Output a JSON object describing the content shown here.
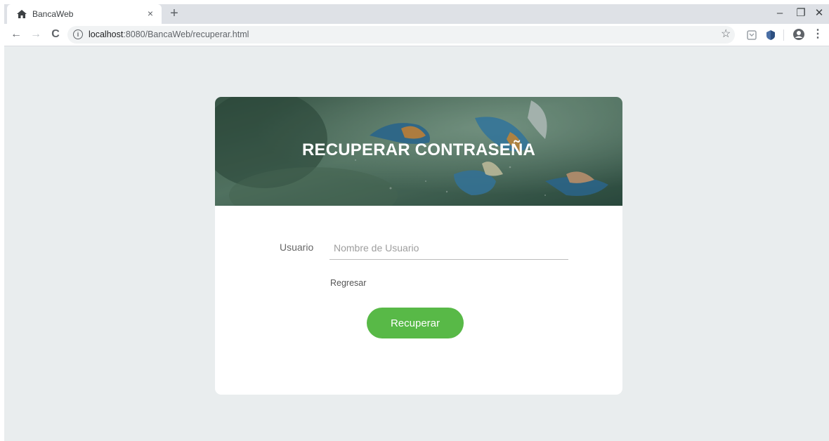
{
  "browser": {
    "tab_title": "BancaWeb",
    "tab_close": "×",
    "new_tab": "+",
    "window_controls": {
      "minimize": "–",
      "restore": "❐",
      "close": "✕"
    },
    "nav": {
      "back": "←",
      "forward": "→",
      "reload": "C"
    },
    "url_host": "localhost",
    "url_rest": ":8080/BancaWeb/recuperar.html",
    "icons": [
      "home-icon",
      "info-icon",
      "star-icon",
      "extension-icon",
      "shield-extension-icon",
      "account-icon",
      "menu-icon"
    ]
  },
  "page": {
    "title": "RECUPERAR CONTRASEÑA",
    "form": {
      "user_label": "Usuario",
      "user_value": "",
      "user_placeholder": "Nombre de Usuario",
      "back_link": "Regresar",
      "submit_label": "Recuperar"
    }
  },
  "colors": {
    "background": "#e9edee",
    "card": "#ffffff",
    "accent": "#58b947"
  }
}
